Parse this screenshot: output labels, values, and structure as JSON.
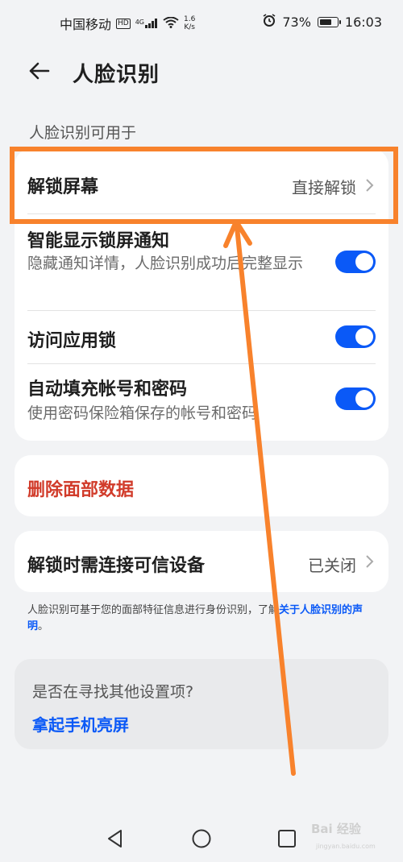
{
  "status_bar": {
    "carrier": "中国移动",
    "hd": "HD",
    "signal_type": "4G",
    "speed_value": "1.6",
    "speed_unit": "K/s",
    "battery": "73%",
    "battery_level": 0.73,
    "time": "16:03"
  },
  "header": {
    "title": "人脸识别"
  },
  "section_label": "人脸识别可用于",
  "settings_card": {
    "unlock_screen": {
      "label": "解锁屏幕",
      "value": "直接解锁"
    },
    "smart_notify": {
      "label": "智能显示锁屏通知",
      "desc": "隐藏通知详情，人脸识别成功后完整显示",
      "enabled": true
    },
    "app_lock": {
      "label": "访问应用锁",
      "enabled": true
    },
    "autofill": {
      "label": "自动填充帐号和密码",
      "desc": "使用密码保险箱保存的帐号和密码",
      "enabled": true
    }
  },
  "delete_card": {
    "label": "删除面部数据",
    "color": "#d13b2a"
  },
  "trusted_device": {
    "label": "解锁时需连接可信设备",
    "value": "已关闭"
  },
  "footnote": {
    "text": "人脸识别可基于您的面部特征信息进行身份识别，了解",
    "link": "关于人脸识别的声明",
    "end": "。"
  },
  "suggestion": {
    "title": "是否在寻找其他设置项?",
    "link": "拿起手机亮屏"
  },
  "watermark": {
    "text": "Bai 经验",
    "sub": "jingyan.baidu.com"
  },
  "colors": {
    "accent": "#0a59f7",
    "highlight": "#f8822c",
    "danger": "#d13b2a",
    "background": "#f2f3f5"
  }
}
